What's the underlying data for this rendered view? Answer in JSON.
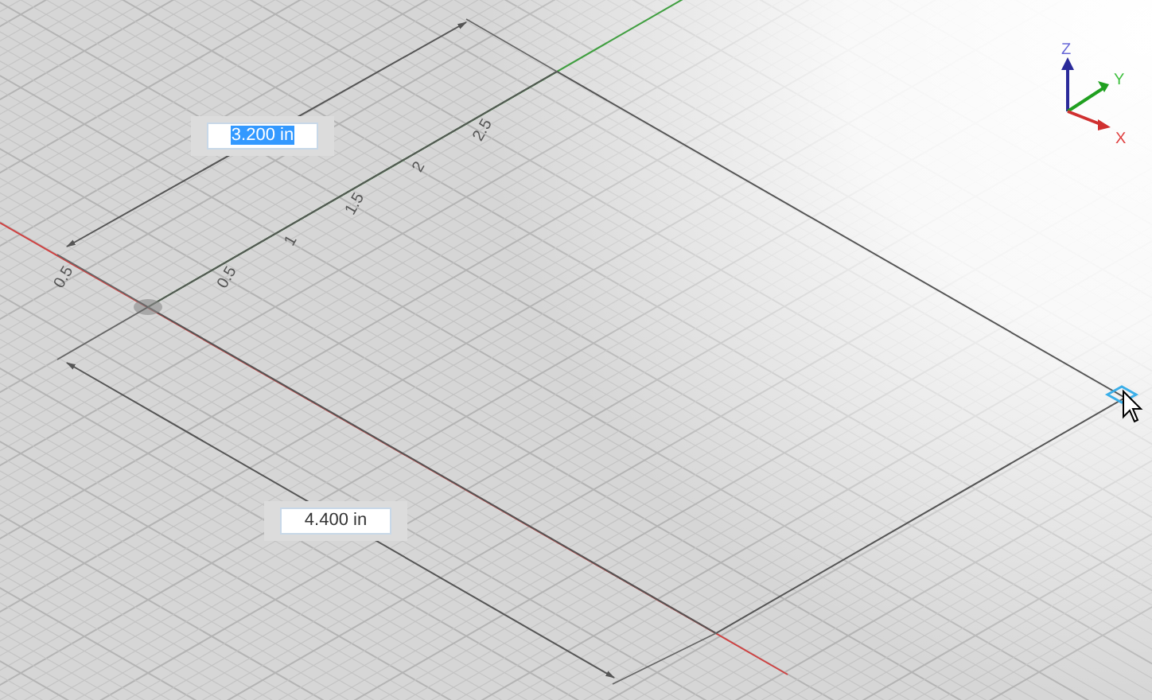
{
  "viewport": {
    "y_axis_ticks": [
      "0.5",
      "1",
      "1.5",
      "2",
      "2.5"
    ],
    "x_axis_ticks": [
      "0.5"
    ],
    "dimension_fields": [
      {
        "value": "3.200 in",
        "selected": true
      },
      {
        "value": "4.400 in",
        "selected": false
      }
    ],
    "view_triad": {
      "z_label": "Z",
      "y_label": "Y",
      "x_label": "X"
    }
  }
}
